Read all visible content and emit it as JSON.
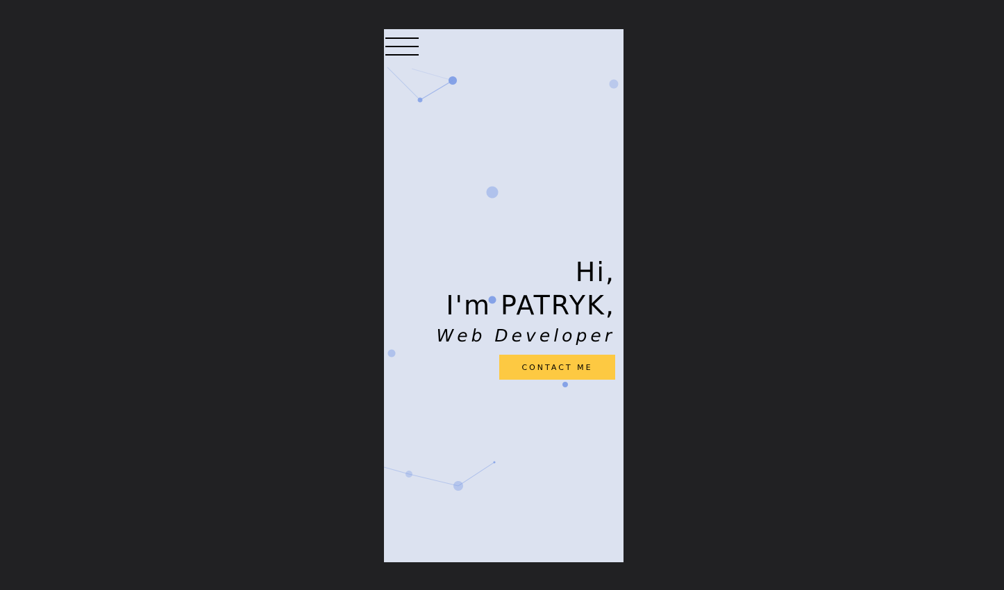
{
  "menu": {
    "icon": "hamburger-menu-icon"
  },
  "hero": {
    "greeting_line1": "Hi,",
    "greeting_line2": "I'm PATRYK,",
    "role": "Web Developer"
  },
  "cta": {
    "label": "CONTACT ME"
  },
  "colors": {
    "page_background": "#212123",
    "screen_background": "#dce2f0",
    "particle": "#7b9be6",
    "button": "#fdc942",
    "text": "#000000"
  }
}
